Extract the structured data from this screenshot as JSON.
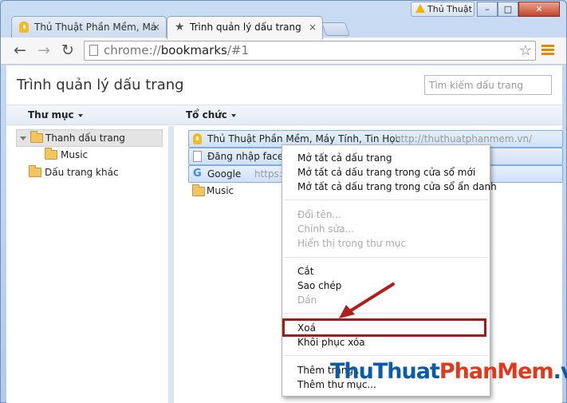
{
  "titlebar": {
    "profile_label": "Thủ Thuật",
    "buttons": [
      "–",
      "□",
      "✕"
    ]
  },
  "tabs": [
    {
      "label": "Thủ Thuật Phần Mềm, Má",
      "close": "×"
    },
    {
      "label": "Trình quản lý dấu trang",
      "close": "×"
    }
  ],
  "toolbar": {
    "url_prefix": "chrome://",
    "url_host": "bookmarks",
    "url_rest": "/#1",
    "star": "☆"
  },
  "page": {
    "title": "Trình quản lý dấu trang",
    "search_placeholder": "Tìm kiếm dấu trang",
    "col_folders": "Thư mục",
    "col_organize": "Tổ chức"
  },
  "tree": [
    {
      "label": "Thanh dấu trang"
    },
    {
      "label": "Music"
    },
    {
      "label": "Dấu trang khác"
    }
  ],
  "bookmarks": [
    {
      "title": "Thủ Thuật Phần Mềm, Máy Tính, Tin Học",
      "url": "http://thuthuatphanmem.vn/",
      "icon": "bulb-icon"
    },
    {
      "title": "Đăng nhập facebook",
      "url": "",
      "icon": "page-icon"
    },
    {
      "title": "Google",
      "url": "https://w",
      "icon": "google-icon"
    },
    {
      "title": "Music",
      "url": "",
      "icon": "folder-icon"
    }
  ],
  "context_menu": {
    "open_all": "Mở tất cả dấu trang",
    "open_all_window": "Mở tất cả dấu trang trong cửa sổ mới",
    "open_all_incognito": "Mở tất cả dấu trang trong cửa sổ ẩn danh",
    "rename": "Đổi tên...",
    "edit": "Chỉnh sửa...",
    "show_in_folder": "Hiển thị trong thư mục",
    "cut": "Cắt",
    "copy": "Sao chép",
    "paste": "Dán",
    "delete": "Xoá",
    "undo_delete": "Khôi phục xóa",
    "add_page": "Thêm trang...",
    "add_folder": "Thêm thư mục..."
  },
  "watermark": {
    "part1": "ThuThuat",
    "part2": "PhanMem",
    "part3": ".vn"
  },
  "colors": {
    "highlight": "#a41a1a",
    "selection": "#cfe1f7"
  }
}
